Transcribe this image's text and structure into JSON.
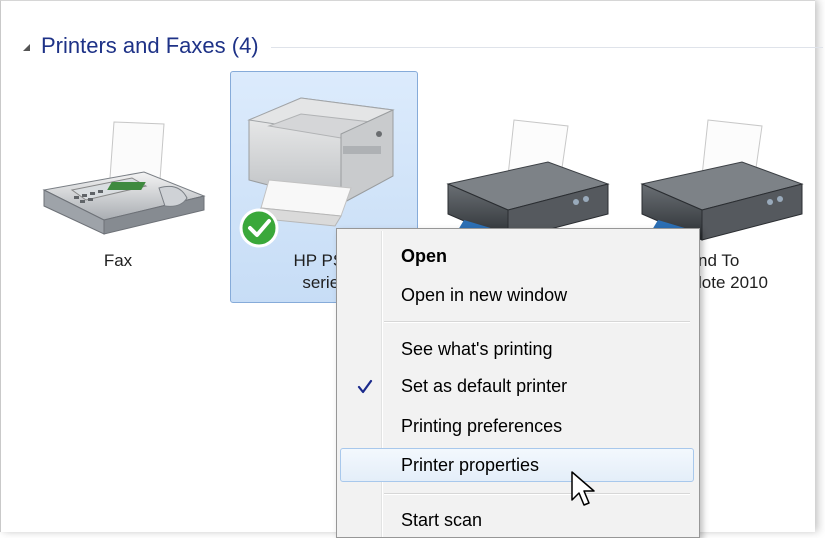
{
  "group": {
    "title": "Printers and Faxes (4)",
    "collapse_icon": "collapse-triangle-icon"
  },
  "devices": [
    {
      "label": "Fax",
      "icon": "fax-icon",
      "selected": false
    },
    {
      "label": "HP PSC\nseries",
      "icon": "all-in-one-printer-icon",
      "selected": true,
      "default": true
    },
    {
      "label": "",
      "icon": "printer-icon",
      "selected": false
    },
    {
      "label": "nd To\nlote 2010",
      "icon": "printer-icon",
      "selected": false
    }
  ],
  "context_menu": {
    "items": [
      {
        "label": "Open",
        "bold": true
      },
      {
        "label": "Open in new window"
      },
      {
        "label": "See what's printing"
      },
      {
        "label": "Set as default printer",
        "checked": true
      },
      {
        "label": "Printing preferences"
      },
      {
        "label": "Printer properties",
        "hovered": true
      },
      {
        "label": "Start scan"
      }
    ]
  },
  "colors": {
    "group_title": "#1e3287",
    "selection_bg": "#c7ddf6",
    "selection_border": "#86abd9",
    "menu_bg": "#f2f2f2",
    "check": "#1b2a8c"
  }
}
